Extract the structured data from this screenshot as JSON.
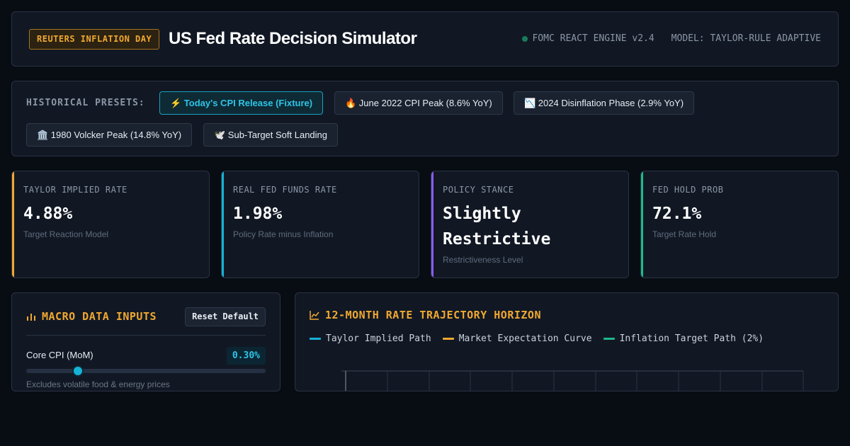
{
  "header": {
    "badge": "REUTERS INFLATION DAY",
    "title": "US Fed Rate Decision Simulator",
    "engine": "FOMC REACT ENGINE v2.4",
    "model": "MODEL: TAYLOR-RULE ADAPTIVE"
  },
  "presets": {
    "label": "HISTORICAL PRESETS:",
    "items": [
      {
        "label": "⚡ Today's CPI Release (Fixture)",
        "active": true
      },
      {
        "label": "🔥 June 2022 CPI Peak (8.6% YoY)",
        "active": false
      },
      {
        "label": "📉 2024 Disinflation Phase (2.9% YoY)",
        "active": false
      },
      {
        "label": "🏛️ 1980 Volcker Peak (14.8% YoY)",
        "active": false
      },
      {
        "label": "🕊️ Sub-Target Soft Landing",
        "active": false
      }
    ]
  },
  "cards": [
    {
      "label": "TAYLOR IMPLIED RATE",
      "value": "4.88%",
      "sub": "Target Reaction Model",
      "color": "#f0a830"
    },
    {
      "label": "REAL FED FUNDS RATE",
      "value": "1.98%",
      "sub": "Policy Rate minus Inflation",
      "color": "#17b3d6"
    },
    {
      "label": "POLICY STANCE",
      "value": "Slightly Restrictive",
      "sub": "Restrictiveness Level",
      "color": "#8b5cf6"
    },
    {
      "label": "FED HOLD PROB",
      "value": "72.1%",
      "sub": "Target Rate Hold",
      "color": "#1fb88a"
    }
  ],
  "macro": {
    "title": "MACRO DATA INPUTS",
    "reset_label": "Reset Default",
    "core_cpi": {
      "label": "Core CPI (MoM)",
      "value": "0.30%",
      "slider_fraction": 0.215,
      "help": "Excludes volatile food & energy prices"
    }
  },
  "chart": {
    "title": "12-MONTH RATE TRAJECTORY HORIZON",
    "legend": [
      {
        "label": "Taylor Implied Path",
        "color": "#17b3d6"
      },
      {
        "label": "Market Expectation Curve",
        "color": "#f0a830"
      },
      {
        "label": "Inflation Target Path (2%)",
        "color": "#1fb88a"
      }
    ]
  },
  "colors": {
    "accent_amber": "#f0a830",
    "accent_cyan": "#17b3d6",
    "accent_purple": "#8b5cf6",
    "accent_green": "#1fb88a",
    "background": "#080c13",
    "panel": "#111824"
  }
}
